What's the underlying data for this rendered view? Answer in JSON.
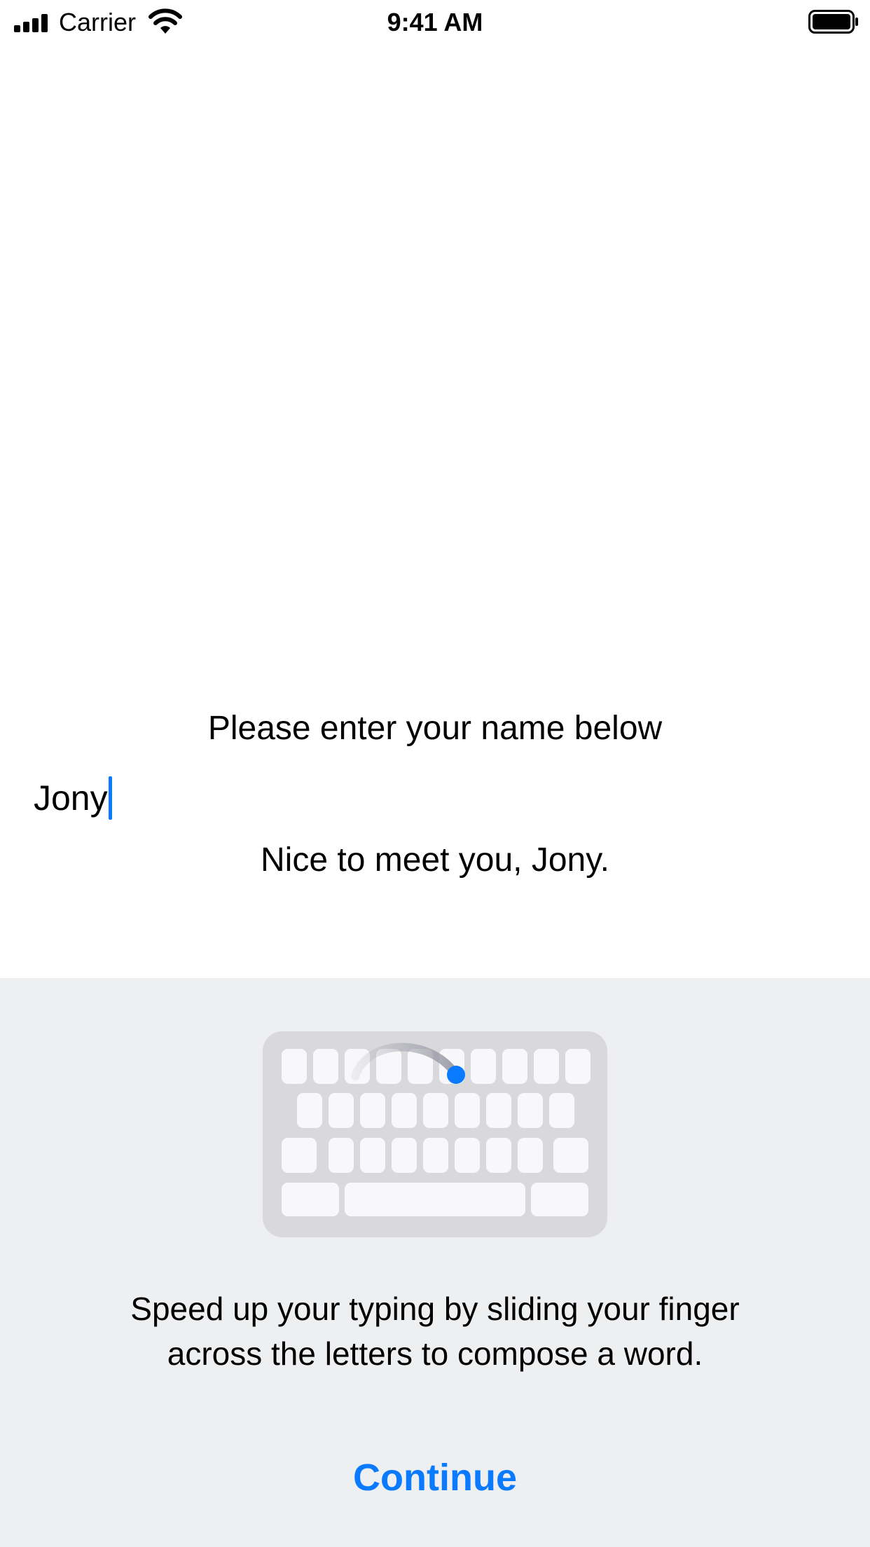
{
  "status_bar": {
    "carrier": "Carrier",
    "time": "9:41 AM",
    "icons": [
      "signal-icon",
      "wifi-icon",
      "battery-icon"
    ]
  },
  "form": {
    "prompt": "Please enter your name below",
    "name_value": "Jony",
    "greeting": "Nice to meet you, Jony."
  },
  "swipe_tip": {
    "illustration": "swipe-keyboard-icon",
    "text_line1": "Speed up your typing by sliding your finger",
    "text_line2": "across the letters to compose a word.",
    "continue_label": "Continue"
  },
  "colors": {
    "accent": "#0a7aff",
    "panel_background": "#eeeff1",
    "keyboard_base": "#d9d9dc",
    "key": "#f8f8fa"
  }
}
